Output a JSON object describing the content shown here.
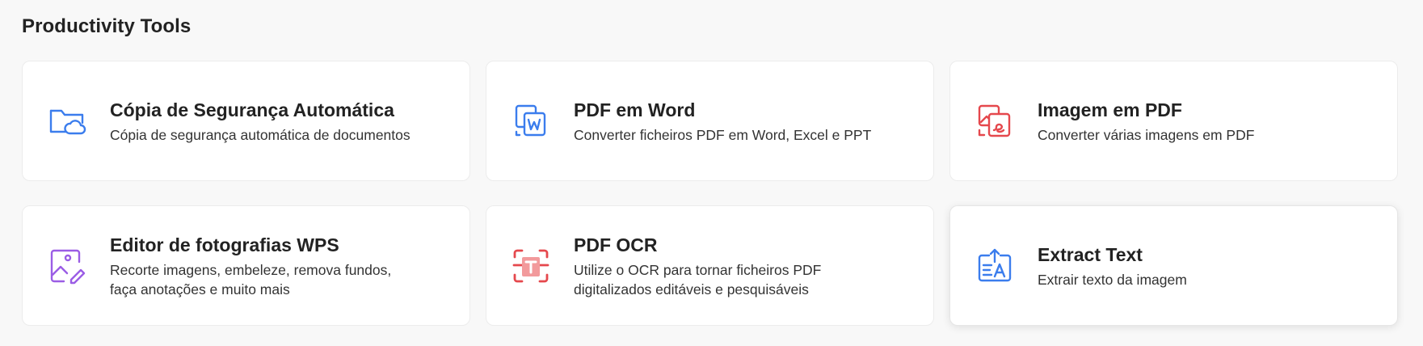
{
  "section": {
    "title": "Productivity Tools"
  },
  "tools": [
    {
      "title": "Cópia de Segurança Automática",
      "description": "Cópia de segurança automática de documentos",
      "icon": "cloud-folder-icon",
      "color": "#3b7ded"
    },
    {
      "title": "PDF em Word",
      "description": "Converter ficheiros PDF em Word, Excel e PPT",
      "icon": "pdf-to-word-icon",
      "color": "#3b7ded"
    },
    {
      "title": "Imagem em PDF",
      "description": "Converter várias imagens em PDF",
      "icon": "image-to-pdf-icon",
      "color": "#e5484d"
    },
    {
      "title": "Editor de fotografias WPS",
      "description": "Recorte imagens, embeleze, remova fundos, faça anotações e muito mais",
      "icon": "photo-editor-icon",
      "color": "#9b5de5"
    },
    {
      "title": "PDF OCR",
      "description": "Utilize o OCR para tornar ficheiros PDF digitalizados editáveis e pesquisáveis",
      "icon": "pdf-ocr-icon",
      "color": "#e5484d"
    },
    {
      "title": "Extract Text",
      "description": "Extrair texto da imagem",
      "icon": "extract-text-icon",
      "color": "#3b7ded"
    }
  ]
}
